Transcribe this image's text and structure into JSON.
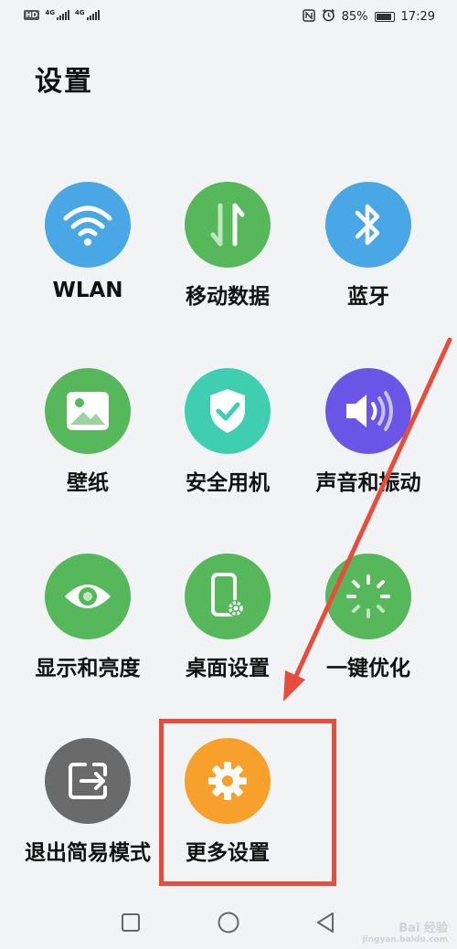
{
  "status_bar": {
    "left_icons": [
      "hd-icon",
      "signal-4g-icon",
      "signal-4g-icon"
    ],
    "right_icons": [
      "nfc-icon",
      "alarm-icon"
    ],
    "battery": "85%",
    "time": "17:29"
  },
  "page": {
    "title": "设置"
  },
  "tiles": [
    {
      "label": "WLAN",
      "icon": "wifi-icon",
      "color": "#4aa7e5"
    },
    {
      "label": "移动数据",
      "icon": "mobile-data-icon",
      "color": "#56b85a"
    },
    {
      "label": "蓝牙",
      "icon": "bluetooth-icon",
      "color": "#4aa7e5"
    },
    {
      "label": "壁纸",
      "icon": "wallpaper-icon",
      "color": "#56b85a"
    },
    {
      "label": "安全用机",
      "icon": "shield-check-icon",
      "color": "#3fcfb0"
    },
    {
      "label": "声音和振动",
      "icon": "speaker-icon",
      "color": "#6a55e6"
    },
    {
      "label": "显示和亮度",
      "icon": "eye-icon",
      "color": "#56b85a"
    },
    {
      "label": "桌面设置",
      "icon": "phone-gear-icon",
      "color": "#56b85a"
    },
    {
      "label": "一键优化",
      "icon": "optimize-icon",
      "color": "#56b85a"
    },
    {
      "label": "退出简易模式",
      "icon": "exit-icon",
      "color": "#6a6a6a"
    },
    {
      "label": "更多设置",
      "icon": "gear-icon",
      "color": "#f7a12c"
    }
  ],
  "annotation": {
    "highlight_color": "#e74c3c"
  },
  "nav_bar": {
    "buttons": [
      "recents-button",
      "home-button",
      "back-button"
    ]
  },
  "watermark": {
    "line1": "Bai 经验",
    "line2": "jingyan.baidu.com"
  }
}
